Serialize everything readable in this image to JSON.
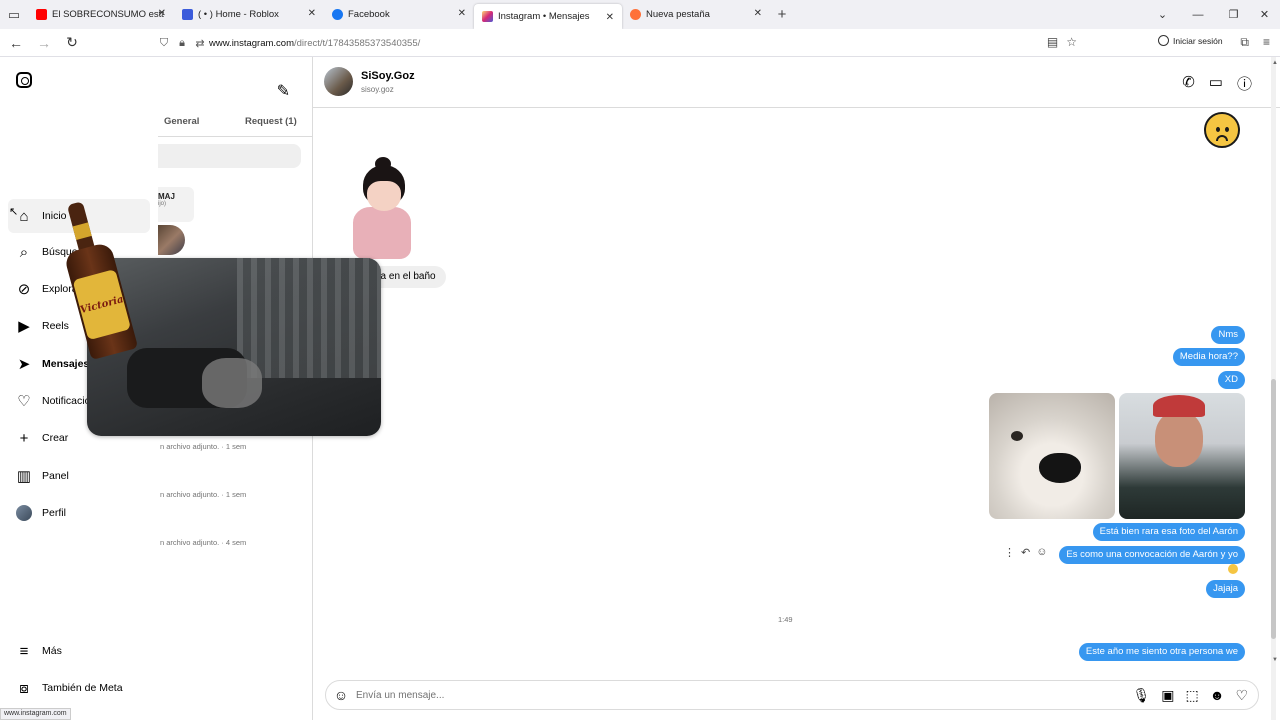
{
  "browser": {
    "tabs": [
      {
        "label": "El SOBRECONSUMO está arruin",
        "icon": "youtube-icon",
        "color": "#ff0000"
      },
      {
        "label": "( • ) Home - Roblox",
        "icon": "roblox-icon",
        "color": "#3b5bdb"
      },
      {
        "label": "Facebook",
        "icon": "facebook-icon",
        "color": "#1877f2"
      },
      {
        "label": "Instagram • Mensajes",
        "icon": "instagram-icon",
        "color": "#e1306c"
      },
      {
        "label": "Nueva pestaña",
        "icon": "firefox-icon",
        "color": "#ff7139"
      }
    ],
    "url_host": "www.instagram.com",
    "url_path": "/direct/t/17843585373540355/",
    "signin_label": "Iniciar sesión",
    "status_url": "www.instagram.com"
  },
  "nav": {
    "items": [
      {
        "label": "Inicio",
        "icon": "home-icon"
      },
      {
        "label": "Búsqueda",
        "icon": "search-icon"
      },
      {
        "label": "Explorar",
        "icon": "explore-icon"
      },
      {
        "label": "Reels",
        "icon": "reels-icon"
      },
      {
        "label": "Mensajes",
        "icon": "messages-icon"
      },
      {
        "label": "Notificaciones",
        "icon": "heart-icon"
      },
      {
        "label": "Crear",
        "icon": "plus-icon"
      },
      {
        "label": "Panel",
        "icon": "panel-icon"
      },
      {
        "label": "Perfil",
        "icon": "avatar"
      }
    ],
    "more_label": "Más",
    "meta_label": "También de Meta"
  },
  "inbox": {
    "tabs": [
      "General",
      "Request (1)"
    ],
    "fragment_name": "MAJ",
    "fragment_sub": "ijo)",
    "meta_rows": [
      "n archivo adjunto. · 1 sem",
      "n archivo adjunto. · 1 sem",
      "n archivo adjunto. · 4 sem"
    ]
  },
  "chat": {
    "name": "SiSoy.Goz",
    "username": "sisoy.goz",
    "incoming_text": "ba en el baño",
    "outgoing": {
      "nms": "Nms",
      "media": "Media hora??",
      "xd": "XD",
      "rara": "Está bien rara esa foto del Aarón",
      "convocacion": "Es como una convocación de Aarón y yo",
      "jajaja": "Jajaja",
      "este": "Este año me siento otra persona we"
    },
    "timestamp": "1:49",
    "composer_placeholder": "Envía un mensaje..."
  },
  "overlay": {
    "bottle_label": "Victoria"
  },
  "colors": {
    "bubble_out": "#3797f0",
    "bubble_in": "#efefef"
  }
}
